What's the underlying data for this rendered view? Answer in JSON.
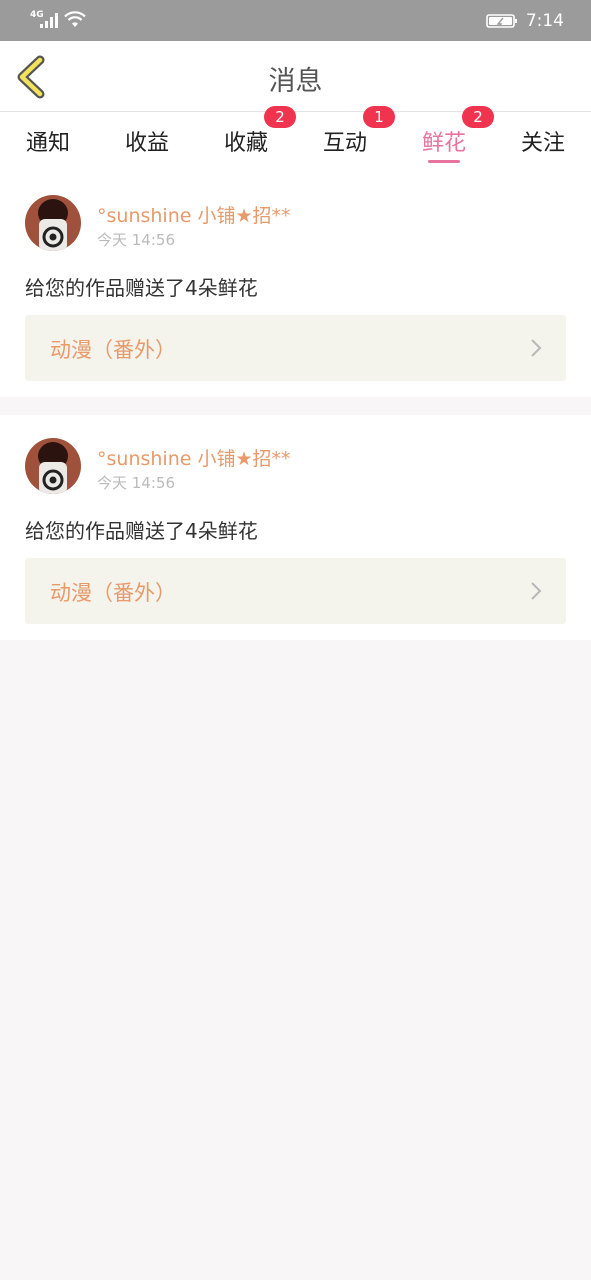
{
  "status_bar": {
    "network": "4G",
    "time": "7:14"
  },
  "header": {
    "title": "消息",
    "back_icon": "chevron-left-icon"
  },
  "colors": {
    "accent": "#e8739c",
    "badge": "#f0344f",
    "username": "#e89a6a",
    "work_bg": "#f4f3ec"
  },
  "tabs": [
    {
      "label": "通知",
      "badge": null,
      "active": false
    },
    {
      "label": "收益",
      "badge": null,
      "active": false
    },
    {
      "label": "收藏",
      "badge": "2",
      "active": false
    },
    {
      "label": "互动",
      "badge": "1",
      "active": false
    },
    {
      "label": "鲜花",
      "badge": "2",
      "active": true
    },
    {
      "label": "关注",
      "badge": null,
      "active": false
    }
  ],
  "messages": [
    {
      "user": "°sunshine 小铺★招**",
      "time": "今天 14:56",
      "text": "给您的作品赠送了4朵鲜花",
      "work": "动漫（番外）"
    },
    {
      "user": "°sunshine 小铺★招**",
      "time": "今天 14:56",
      "text": "给您的作品赠送了4朵鲜花",
      "work": "动漫（番外）"
    }
  ]
}
